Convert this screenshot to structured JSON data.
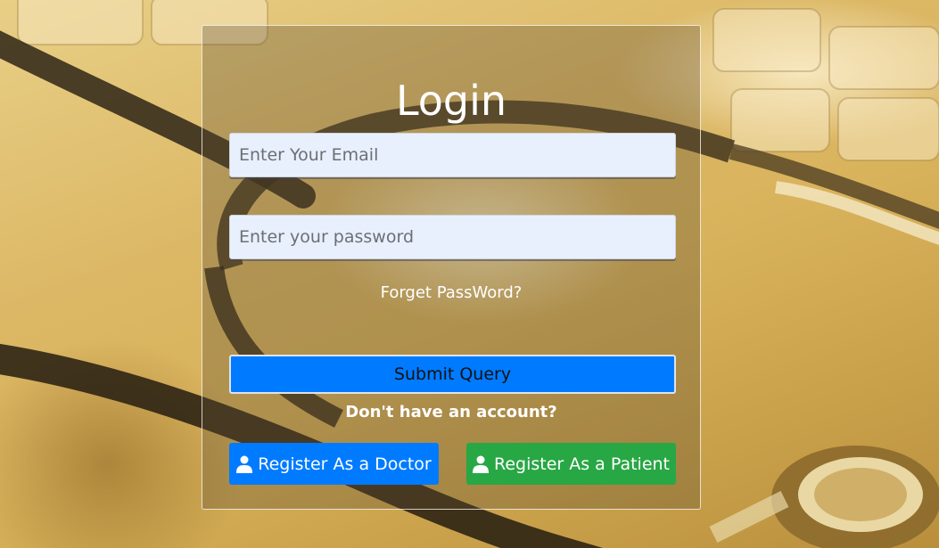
{
  "login": {
    "title": "Login",
    "email_placeholder": "Enter Your Email",
    "password_placeholder": "Enter your password",
    "forgot_label": "Forget PassWord?",
    "submit_label": "Submit Query",
    "no_account_text": "Don't have an account?",
    "register_doctor_label": "Register As a Doctor",
    "register_patient_label": "Register As a Patient"
  },
  "icons": {
    "register_doctor": "user-icon",
    "register_patient": "user-icon"
  },
  "colors": {
    "primary": "#007bff",
    "success": "#28a745",
    "input_bg": "#e8f0fe"
  }
}
